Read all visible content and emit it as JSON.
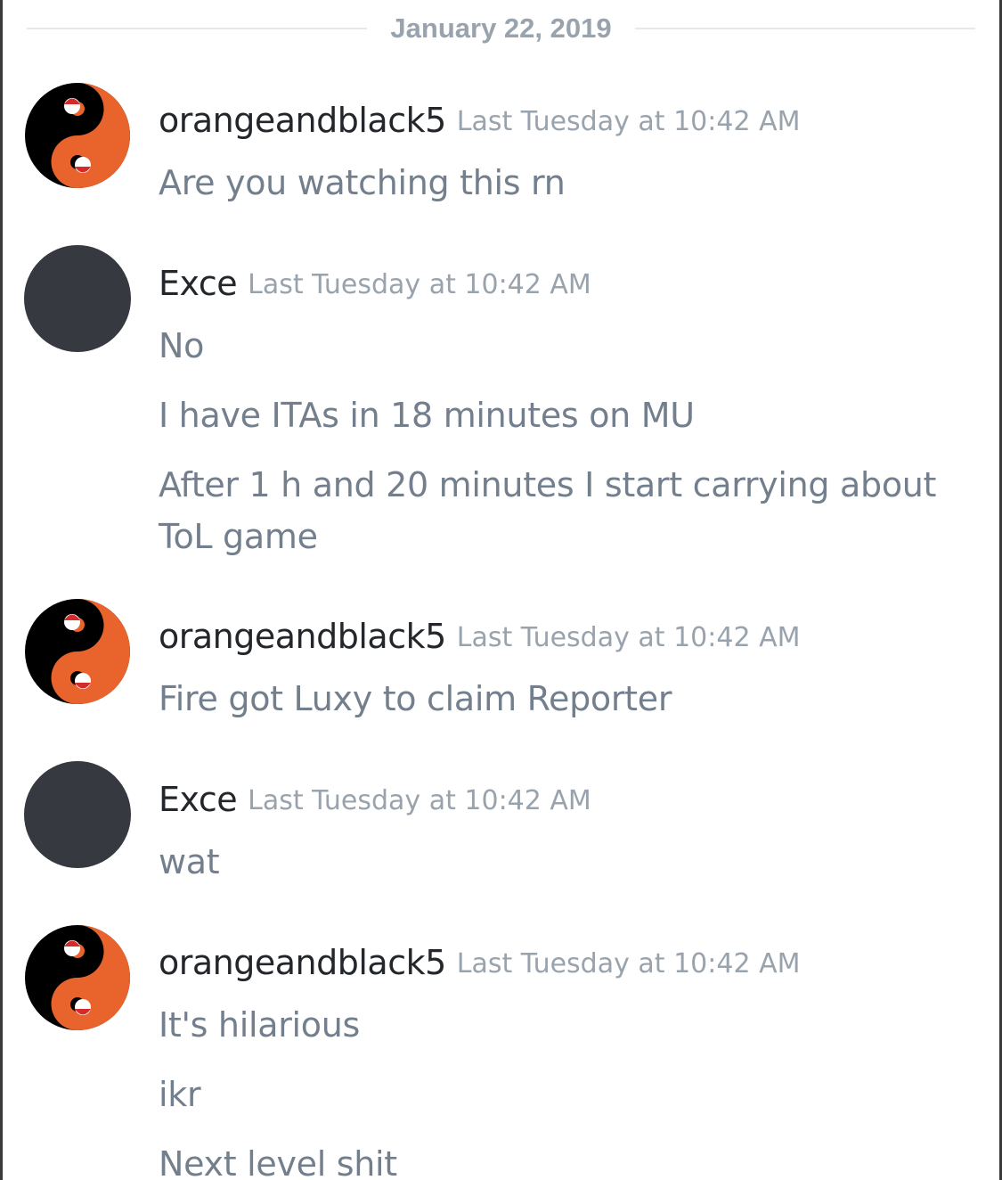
{
  "date_divider": "January 22, 2019",
  "groups": [
    {
      "username": "orangeandblack5",
      "timestamp": "Last Tuesday at 10:42 AM",
      "avatar": "yin-yang-icon",
      "messages": [
        "Are you watching this rn"
      ]
    },
    {
      "username": "Exce",
      "timestamp": "Last Tuesday at 10:42 AM",
      "avatar": "default-dark-avatar",
      "messages": [
        "No",
        "I have ITAs in 18 minutes on MU",
        "After 1 h and 20 minutes I start carrying about ToL game"
      ]
    },
    {
      "username": "orangeandblack5",
      "timestamp": "Last Tuesday at 10:42 AM",
      "avatar": "yin-yang-icon",
      "messages": [
        "Fire got Luxy to claim Reporter"
      ]
    },
    {
      "username": "Exce",
      "timestamp": "Last Tuesday at 10:42 AM",
      "avatar": "default-dark-avatar",
      "messages": [
        "wat"
      ]
    },
    {
      "username": "orangeandblack5",
      "timestamp": "Last Tuesday at 10:42 AM",
      "avatar": "yin-yang-icon",
      "messages": [
        "It's hilarious",
        "ikr",
        "Next level shit"
      ]
    }
  ],
  "colors": {
    "username": "#23262a",
    "timestamp": "#99a3ad",
    "message_text": "#737f8d",
    "avatar_orange": "#e8642c",
    "avatar_dark": "#36393f"
  }
}
